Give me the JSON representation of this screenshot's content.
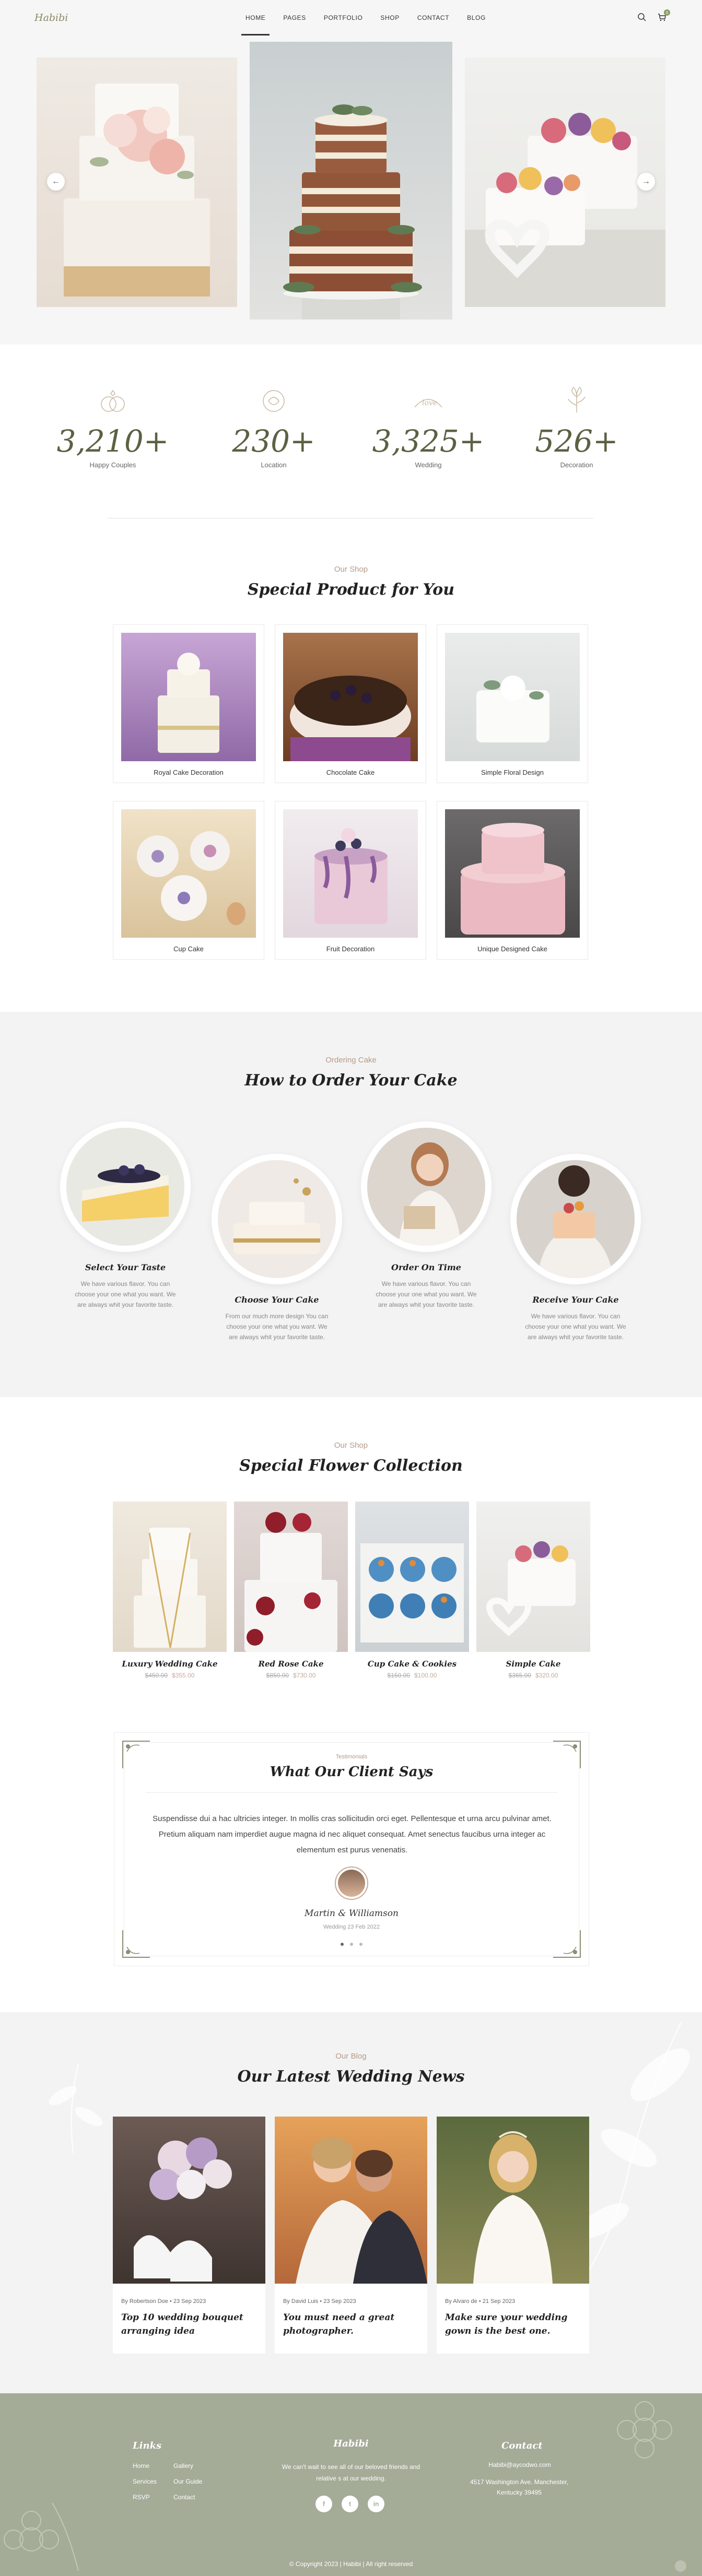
{
  "header": {
    "logo": "Habibi",
    "nav": [
      "HOME",
      "PAGES",
      "PORTFOLIO",
      "SHOP",
      "CONTACT",
      "BLOG"
    ],
    "cart_count": "0"
  },
  "hero": {
    "prev": "←",
    "next": "→"
  },
  "stats": [
    {
      "value": "3,210+",
      "label": "Happy Couples"
    },
    {
      "value": "230+",
      "label": "Location"
    },
    {
      "value": "3,325+",
      "label": "Wedding"
    },
    {
      "value": "526+",
      "label": "Decoration"
    }
  ],
  "shop": {
    "kicker": "Our Shop",
    "title": "Special Product for You",
    "products": [
      "Royal Cake Decoration",
      "Chocolate Cake",
      "Simple Floral Design",
      "Cup Cake",
      "Fruit Decoration",
      "Unique Designed Cake"
    ]
  },
  "order": {
    "kicker": "Ordering Cake",
    "title": "How to Order Your Cake",
    "steps": [
      {
        "title": "Select Your Taste",
        "desc": "We have various flavor. You can choose your one what you want. We are always whit your favorite taste."
      },
      {
        "title": "Choose Your Cake",
        "desc": "From our much more design You can choose your one what you want. We are always whit your favorite taste."
      },
      {
        "title": "Order On Time",
        "desc": "We have various flavor. You can choose your one what you want. We are always whit your favorite taste."
      },
      {
        "title": "Receive Your Cake",
        "desc": "We have various flavor. You can choose your one what you want. We are always whit your favorite taste."
      }
    ]
  },
  "flowers": {
    "kicker": "Our Shop",
    "title": "Special Flower Collection",
    "items": [
      {
        "name": "Luxury Wedding Cake",
        "old": "$450.00",
        "new": "$355.00"
      },
      {
        "name": "Red Rose Cake",
        "old": "$850.00",
        "new": "$730.00"
      },
      {
        "name": "Cup Cake & Cookies",
        "old": "$150.00",
        "new": "$100.00"
      },
      {
        "name": "Simple Cake",
        "old": "$365.00",
        "new": "$320.00"
      }
    ]
  },
  "testimonial": {
    "kicker": "Testimonials",
    "title": "What Our Client Says",
    "text": "Suspendisse dui a hac ultricies integer. In mollis cras sollicitudin orci eget. Pellentesque et urna arcu pulvinar amet. Pretium aliquam nam imperdiet augue magna id nec aliquet consequat. Amet senectus faucibus urna integer ac elementum est purus venenatis.",
    "name": "Martin & Williamson",
    "date": "Wedding 23 Feb 2022"
  },
  "blog": {
    "kicker": "Our Blog",
    "title": "Our Latest Wedding News",
    "posts": [
      {
        "meta": "By Robertson Doe  •  23 Sep 2023",
        "title": "Top 10 wedding bouquet arranging idea"
      },
      {
        "meta": "By David Luis  •  23 Sep 2023",
        "title": "You must need a great photographer."
      },
      {
        "meta": "By Alvaro de  •  21 Sep 2023",
        "title": "Make sure your wedding gown is the best one."
      }
    ]
  },
  "footer": {
    "links_title": "Links",
    "links_col1": [
      "Home",
      "Services",
      "RSVP"
    ],
    "links_col2": [
      "Gallery",
      "Our Guide",
      "Contact"
    ],
    "brand": "Habibi",
    "tagline": "We can't wait to see all of our beloved friends and relative s at our wedding.",
    "social": [
      "f",
      "t",
      "in"
    ],
    "contact_title": "Contact",
    "email": "Habibi@aycodwo.com",
    "address": "4517 Washington Ave. Manchester, Kentucky 39495",
    "copyright": "© Copyright 2023 | Habibi | All right reserved"
  }
}
